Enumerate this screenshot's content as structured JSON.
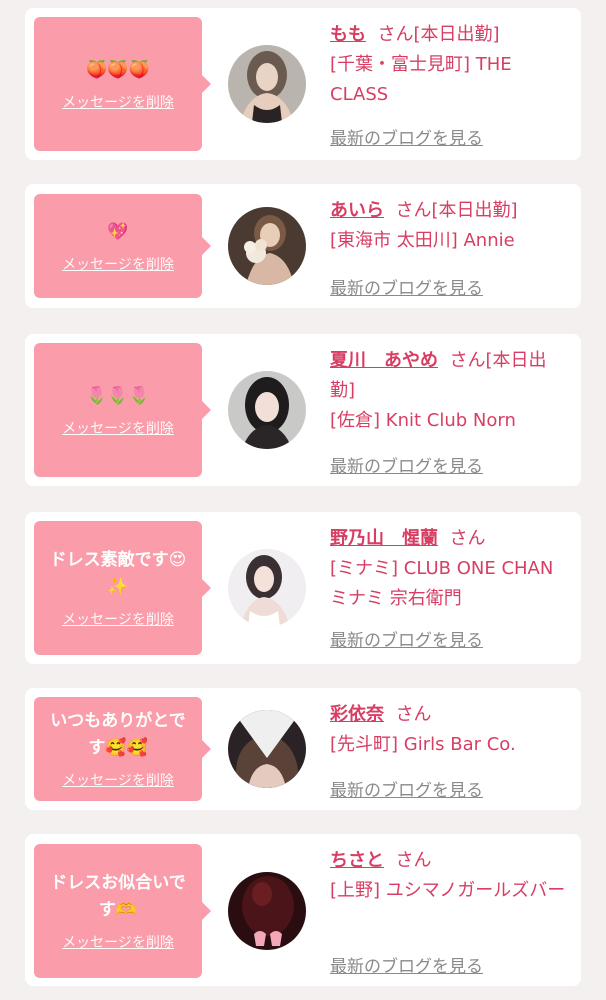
{
  "delete_label": "メッセージを削除",
  "blog_label": "最新のブログを見る",
  "san_label": "さん",
  "cards": [
    {
      "message": "🍑🍑🍑",
      "name": "もも",
      "status": "[本日出勤]",
      "shop": "[千葉・富士見町] THE CLASS",
      "avatar_icon": "woman-portrait-icon"
    },
    {
      "message": "💖",
      "name": "あいら",
      "status": "[本日出勤]",
      "shop": "[東海市 太田川] Annie",
      "avatar_icon": "woman-bouquet-icon"
    },
    {
      "message": "🌷🌷🌷",
      "name": "夏川　あやめ",
      "status": "[本日出勤]",
      "shop": "[佐倉] Knit Club Norn",
      "avatar_icon": "woman-dark-hair-icon"
    },
    {
      "message": "ドレス素敵です😍✨",
      "name": "野乃山　惺蘭",
      "status": "",
      "shop": "[ミナミ] CLUB ONE CHAN ミナミ 宗右衛門",
      "avatar_icon": "woman-dress-icon"
    },
    {
      "message": "いつもありがとです🥰🥰",
      "name": "彩依奈",
      "status": "",
      "shop": "[先斗町] Girls Bar Co.",
      "avatar_icon": "woman-hidden-face-icon"
    },
    {
      "message": "ドレスお似合いです🫶",
      "name": "ちさと",
      "status": "",
      "shop": "[上野] ユシマノガールズバー",
      "avatar_icon": "woman-dark-red-icon"
    }
  ]
}
